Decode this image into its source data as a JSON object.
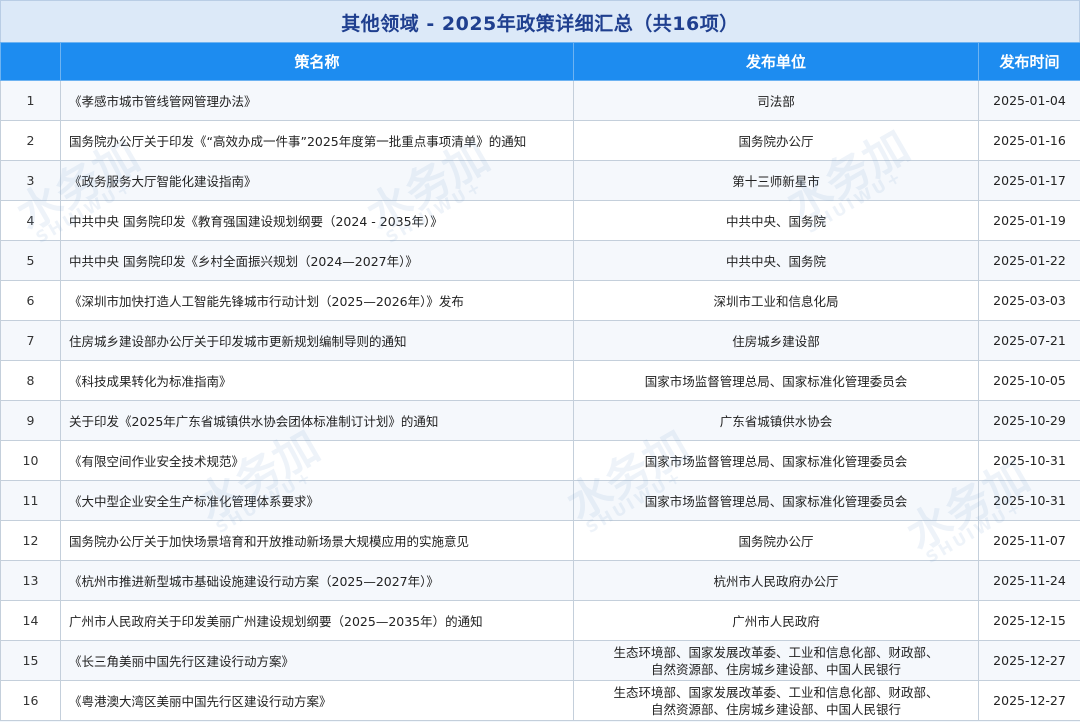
{
  "title": "其他领域 - 2025年政策详细汇总（共16项）",
  "columns": {
    "no": "",
    "name": "策名称",
    "org": "发布单位",
    "date": "发布时间"
  },
  "watermark": {
    "text": "水务加",
    "sub": "SHUIWU+"
  },
  "rows": [
    {
      "no": "1",
      "name": "《孝感市城市管线管网管理办法》",
      "org": [
        "司法部"
      ],
      "date": "2025-01-04"
    },
    {
      "no": "2",
      "name": "国务院办公厅关于印发《“高效办成一件事”2025年度第一批重点事项清单》的通知",
      "org": [
        "国务院办公厅"
      ],
      "date": "2025-01-16"
    },
    {
      "no": "3",
      "name": "《政务服务大厅智能化建设指南》",
      "org": [
        "第十三师新星市"
      ],
      "date": "2025-01-17"
    },
    {
      "no": "4",
      "name": "中共中央 国务院印发《教育强国建设规划纲要（2024 - 2035年）》",
      "org": [
        "中共中央、国务院"
      ],
      "date": "2025-01-19"
    },
    {
      "no": "5",
      "name": "中共中央  国务院印发《乡村全面振兴规划（2024—2027年）》",
      "org": [
        "中共中央、国务院"
      ],
      "date": "2025-01-22"
    },
    {
      "no": "6",
      "name": "《深圳市加快打造人工智能先锋城市行动计划（2025—2026年）》发布",
      "org": [
        "深圳市工业和信息化局"
      ],
      "date": "2025-03-03"
    },
    {
      "no": "7",
      "name": "住房城乡建设部办公厅关于印发城市更新规划编制导则的通知",
      "org": [
        "住房城乡建设部"
      ],
      "date": "2025-07-21"
    },
    {
      "no": "8",
      "name": "《科技成果转化为标准指南》",
      "org": [
        "国家市场监督管理总局、国家标准化管理委员会"
      ],
      "date": "2025-10-05"
    },
    {
      "no": "9",
      "name": "关于印发《2025年广东省城镇供水协会团体标准制订计划》的通知",
      "org": [
        "广东省城镇供水协会"
      ],
      "date": "2025-10-29"
    },
    {
      "no": "10",
      "name": "《有限空间作业安全技术规范》",
      "org": [
        "国家市场监督管理总局、国家标准化管理委员会"
      ],
      "date": "2025-10-31"
    },
    {
      "no": "11",
      "name": "《大中型企业安全生产标准化管理体系要求》",
      "org": [
        "国家市场监督管理总局、国家标准化管理委员会"
      ],
      "date": "2025-10-31"
    },
    {
      "no": "12",
      "name": "国务院办公厅关于加快场景培育和开放推动新场景大规模应用的实施意见",
      "org": [
        "国务院办公厅"
      ],
      "date": "2025-11-07"
    },
    {
      "no": "13",
      "name": "《杭州市推进新型城市基础设施建设行动方案（2025—2027年）》",
      "org": [
        "杭州市人民政府办公厅"
      ],
      "date": "2025-11-24"
    },
    {
      "no": "14",
      "name": "广州市人民政府关于印发美丽广州建设规划纲要（2025—2035年）的通知",
      "org": [
        "广州市人民政府"
      ],
      "date": "2025-12-15"
    },
    {
      "no": "15",
      "name": "《长三角美丽中国先行区建设行动方案》",
      "org": [
        "生态环境部、国家发展改革委、工业和信息化部、财政部、",
        "自然资源部、住房城乡建设部、中国人民银行"
      ],
      "date": "2025-12-27"
    },
    {
      "no": "16",
      "name": "《粤港澳大湾区美丽中国先行区建设行动方案》",
      "org": [
        "生态环境部、国家发展改革委、工业和信息化部、财政部、",
        "自然资源部、住房城乡建设部、中国人民银行"
      ],
      "date": "2025-12-27"
    }
  ]
}
